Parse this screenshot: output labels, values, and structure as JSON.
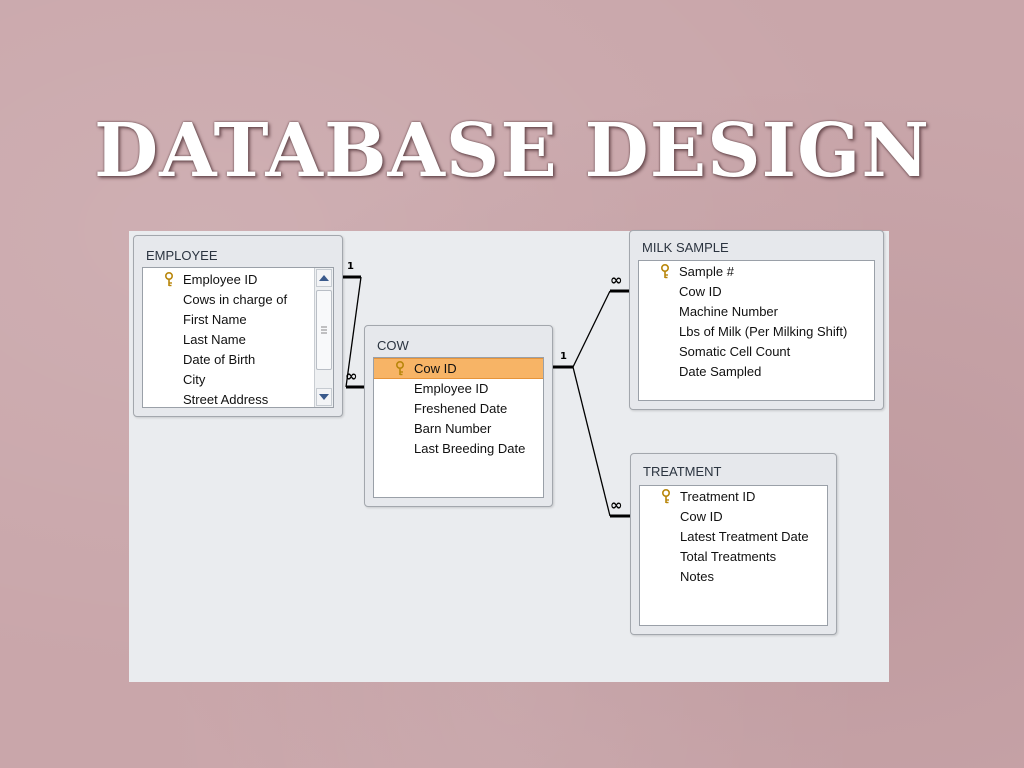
{
  "slide": {
    "title": "DATABASE DESIGN"
  },
  "tables": {
    "employee": {
      "name": "EMPLOYEE",
      "fields": [
        "Employee ID",
        "Cows in charge of",
        "First Name",
        "Last Name",
        "Date of Birth",
        "City",
        "Street Address"
      ]
    },
    "cow": {
      "name": "COW",
      "fields": [
        "Cow ID",
        "Employee ID",
        "Freshened Date",
        "Barn Number",
        "Last Breeding Date"
      ]
    },
    "milk_sample": {
      "name": "MILK SAMPLE",
      "fields": [
        "Sample #",
        "Cow ID",
        "Machine Number",
        "Lbs of Milk (Per Milking Shift)",
        "Somatic Cell Count",
        "Date Sampled"
      ]
    },
    "treatment": {
      "name": "TREATMENT",
      "fields": [
        "Treatment ID",
        "Cow ID",
        "Latest Treatment Date",
        "Total Treatments",
        "Notes"
      ]
    }
  },
  "relationships": {
    "one_symbol": "1",
    "many_symbol": "∞"
  },
  "colors": {
    "background": "#c9a6aa",
    "selected_row": "#f7b466",
    "panel": "#eaecef"
  },
  "icons": {
    "primary_key": "key-icon",
    "scroll_up": "arrow-up-icon",
    "scroll_down": "arrow-down-icon",
    "grip": "scroll-grip-icon"
  }
}
